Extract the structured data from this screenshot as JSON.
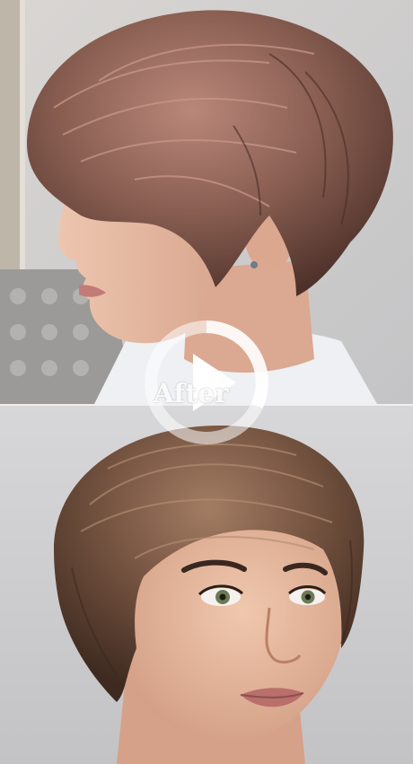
{
  "overlay": {
    "label": "After",
    "icon": "play-icon"
  },
  "colors": {
    "overlay_white": "#ffffff",
    "hair_top": "#7a5548",
    "hair_bottom": "#6e4e3c",
    "skin": "#e6b9a2",
    "background": "#c9c9cb"
  }
}
